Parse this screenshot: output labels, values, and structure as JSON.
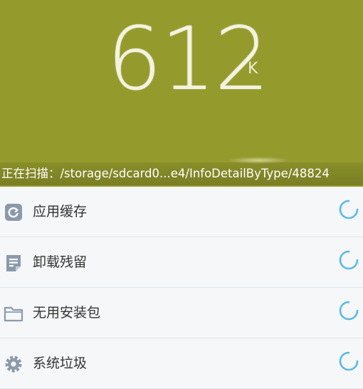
{
  "scan": {
    "size_value": "612",
    "size_unit": "K",
    "status_text": "正在扫描：/storage/sdcard0...e4/InfoDetailByType/48824"
  },
  "categories": [
    {
      "label": "应用缓存",
      "icon": "app-cache-icon"
    },
    {
      "label": "卸载残留",
      "icon": "document-icon"
    },
    {
      "label": "无用安装包",
      "icon": "folder-icon"
    },
    {
      "label": "系统垃圾",
      "icon": "gear-icon"
    }
  ],
  "colors": {
    "header_bg": "#949a2c",
    "icon_color": "#8b9aab",
    "spinner_color": "#5bb8e8"
  }
}
